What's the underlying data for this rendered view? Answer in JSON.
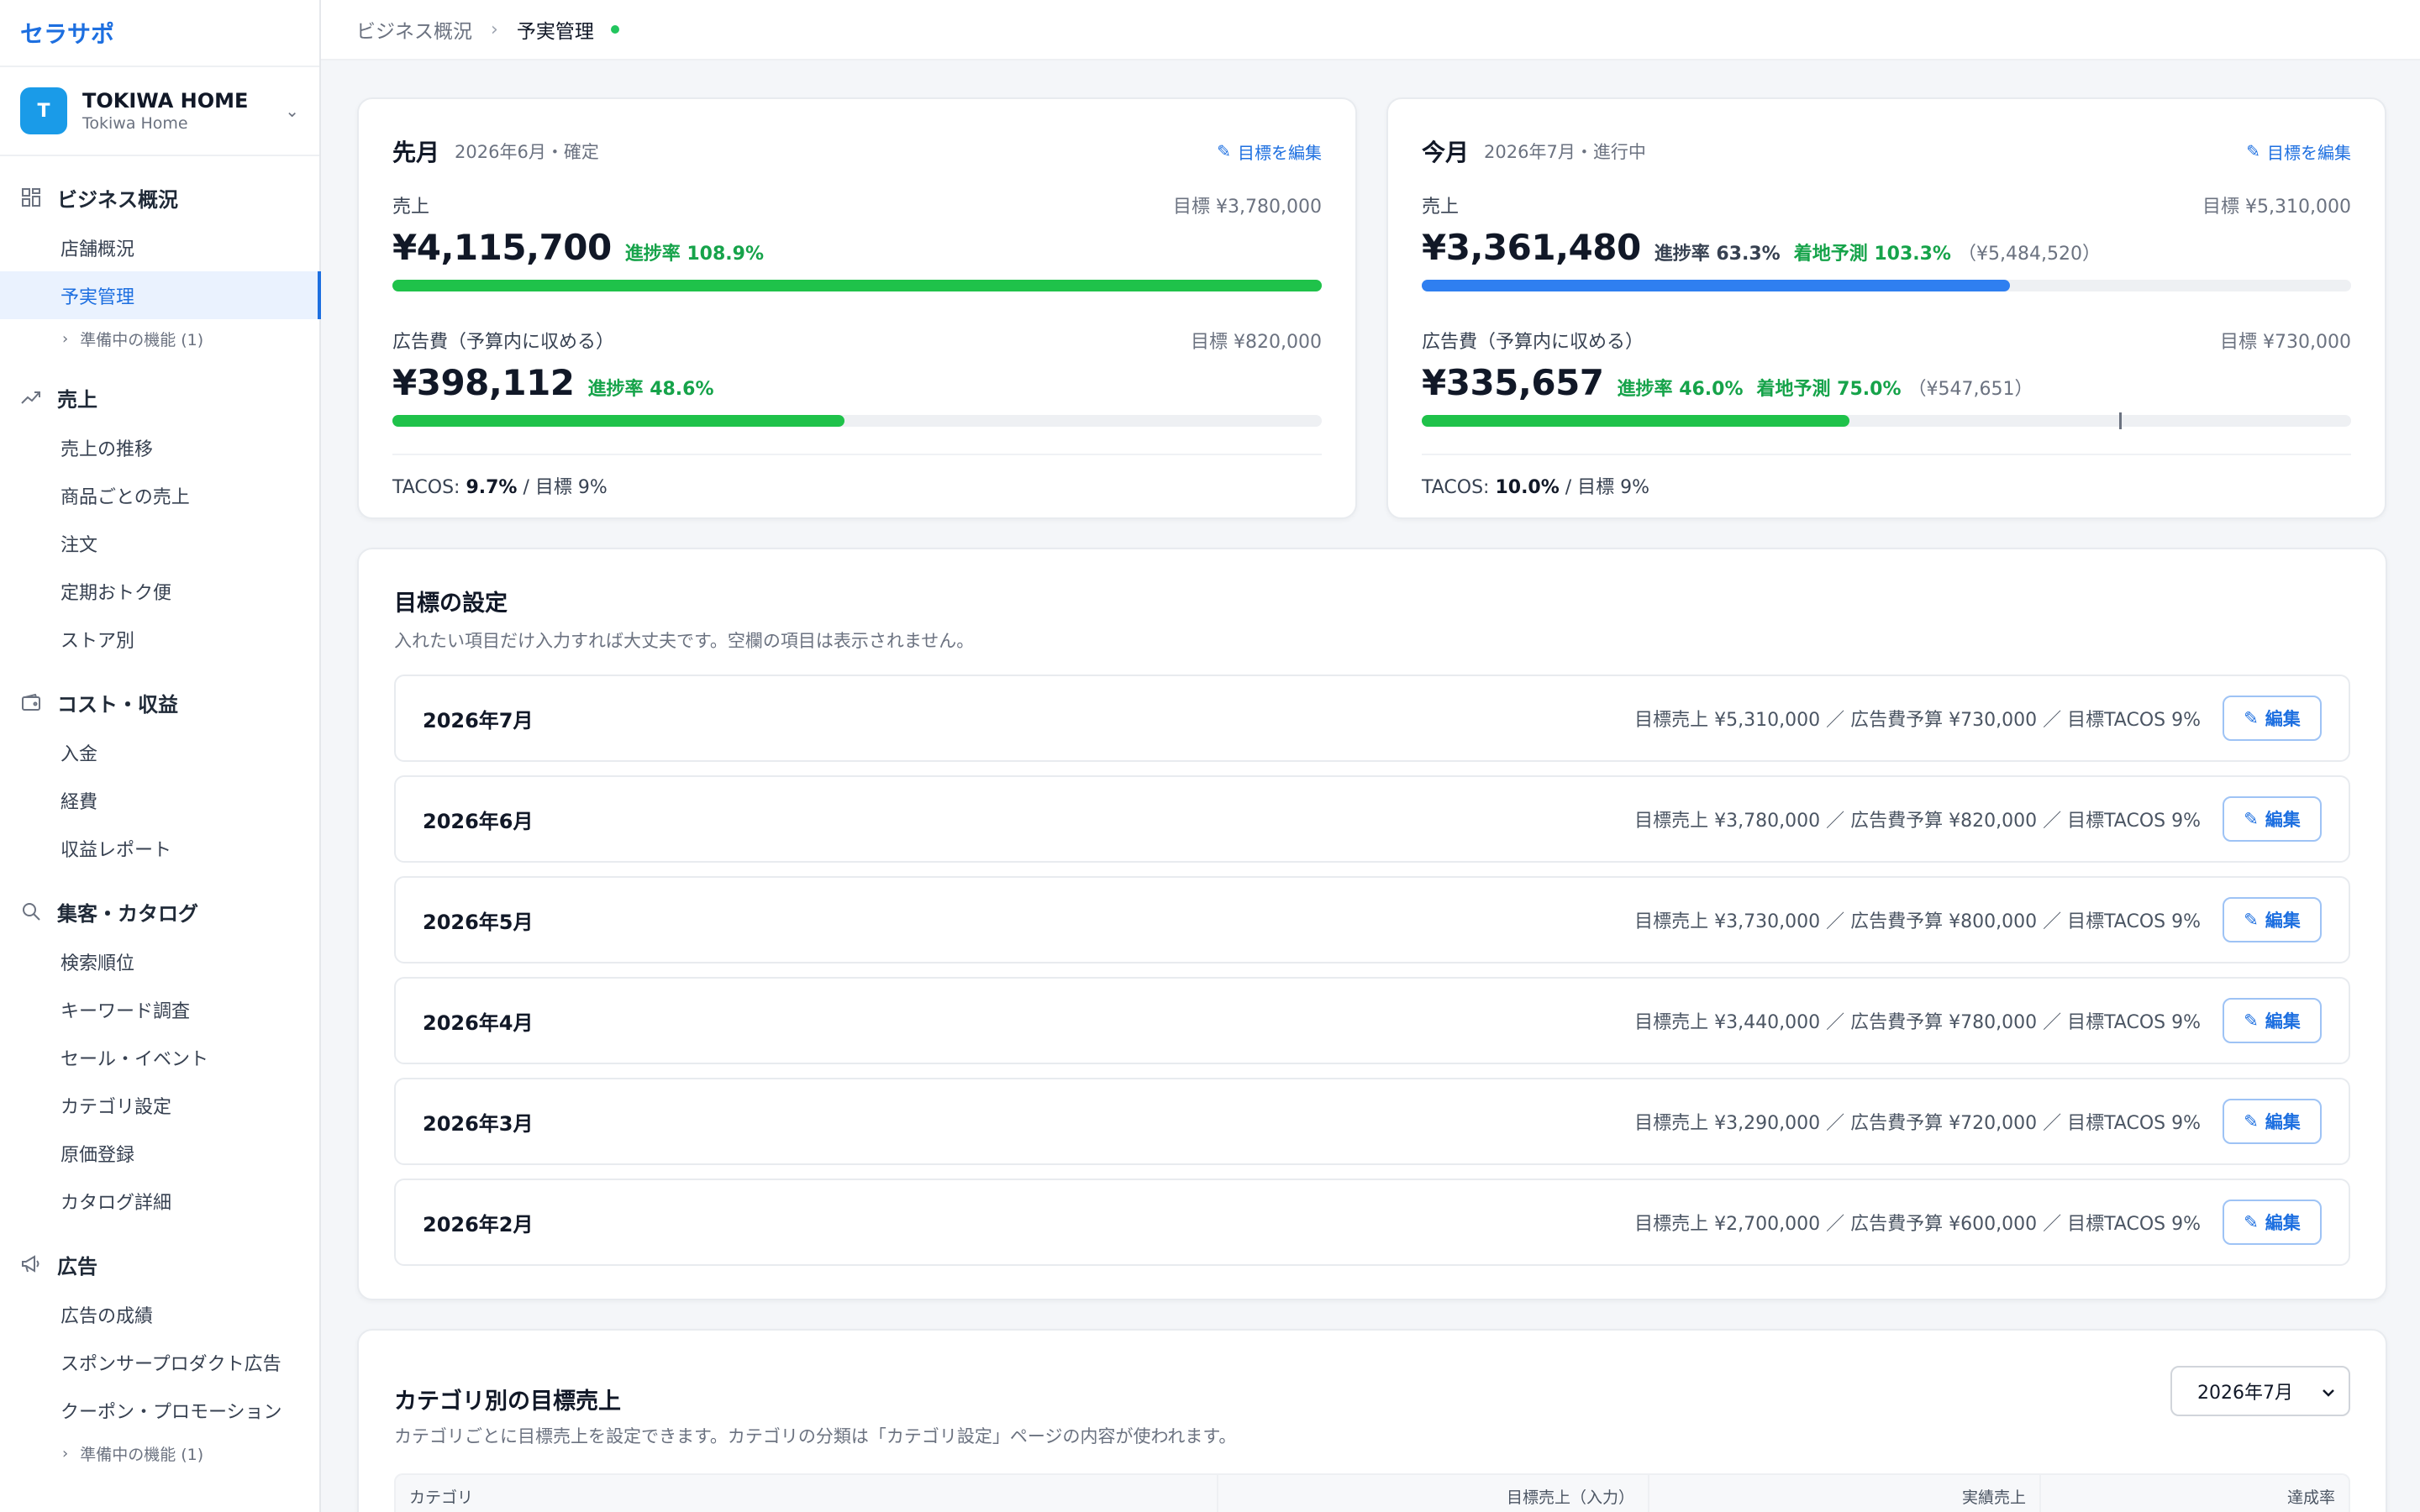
{
  "app": {
    "brand": "セラサポ"
  },
  "workspace": {
    "avatar": "T",
    "name": "TOKIWA HOME",
    "sub": "Tokiwa Home"
  },
  "nav": {
    "business": {
      "label": "ビジネス概況",
      "items": [
        "店舗概況",
        "予実管理"
      ],
      "more": "準備中の機能 (1)"
    },
    "sales": {
      "label": "売上",
      "items": [
        "売上の推移",
        "商品ごとの売上",
        "注文",
        "定期おトク便",
        "ストア別"
      ]
    },
    "cost": {
      "label": "コスト・収益",
      "items": [
        "入金",
        "経費",
        "収益レポート"
      ]
    },
    "acquisition": {
      "label": "集客・カタログ",
      "items": [
        "検索順位",
        "キーワード調査",
        "セール・イベント",
        "カテゴリ設定",
        "原価登録",
        "カタログ詳細"
      ]
    },
    "ads": {
      "label": "広告",
      "items": [
        "広告の成績",
        "スポンサープロダクト広告",
        "クーポン・プロモーション"
      ],
      "more": "準備中の機能 (1)"
    }
  },
  "breadcrumb": {
    "parent": "ビジネス概況",
    "current": "予実管理"
  },
  "cards": {
    "last_month": {
      "title": "先月",
      "sub": "2026年6月・確定",
      "edit": "目標を編集",
      "sales_label": "売上",
      "sales_target": "目標 ¥3,780,000",
      "sales_value": "¥4,115,700",
      "sales_rate": "進捗率 108.9%",
      "sales_progress": 1.0,
      "ad_label": "広告費（予算内に収める）",
      "ad_target": "目標 ¥820,000",
      "ad_value": "¥398,112",
      "ad_rate": "進捗率 48.6%",
      "ad_progress": 0.486,
      "tacos_prefix": "TACOS: ",
      "tacos_value": "9.7%",
      "tacos_suffix": " / 目標 9%"
    },
    "this_month": {
      "title": "今月",
      "sub": "2026年7月・進行中",
      "edit": "目標を編集",
      "sales_label": "売上",
      "sales_target": "目標 ¥5,310,000",
      "sales_value": "¥3,361,480",
      "sales_rate": "進捗率 63.3%",
      "sales_forecast": "着地予測 103.3%",
      "sales_forecast_amount": "（¥5,484,520）",
      "sales_progress": 0.633,
      "ad_label": "広告費（予算内に収める）",
      "ad_target": "目標 ¥730,000",
      "ad_value": "¥335,657",
      "ad_rate": "進捗率 46.0%",
      "ad_forecast": "着地予測 75.0%",
      "ad_forecast_amount": "（¥547,651）",
      "ad_progress": 0.46,
      "ad_forecast_marker": 0.75,
      "tacos_prefix": "TACOS: ",
      "tacos_value": "10.0%",
      "tacos_suffix": " / 目標 9%"
    }
  },
  "goals": {
    "title": "目標の設定",
    "desc": "入れたい項目だけ入力すれば大丈夫です。空欄の項目は表示されません。",
    "edit_label": "編集",
    "rows": [
      {
        "month": "2026年7月",
        "summary": "目標売上 ¥5,310,000 ／ 広告費予算 ¥730,000 ／ 目標TACOS 9%"
      },
      {
        "month": "2026年6月",
        "summary": "目標売上 ¥3,780,000 ／ 広告費予算 ¥820,000 ／ 目標TACOS 9%"
      },
      {
        "month": "2026年5月",
        "summary": "目標売上 ¥3,730,000 ／ 広告費予算 ¥800,000 ／ 目標TACOS 9%"
      },
      {
        "month": "2026年4月",
        "summary": "目標売上 ¥3,440,000 ／ 広告費予算 ¥780,000 ／ 目標TACOS 9%"
      },
      {
        "month": "2026年3月",
        "summary": "目標売上 ¥3,290,000 ／ 広告費予算 ¥720,000 ／ 目標TACOS 9%"
      },
      {
        "month": "2026年2月",
        "summary": "目標売上 ¥2,700,000 ／ 広告費予算 ¥600,000 ／ 目標TACOS 9%"
      }
    ]
  },
  "category": {
    "title": "カテゴリ別の目標売上",
    "desc": "カテゴリごとに目標売上を設定できます。カテゴリの分類は「カテゴリ設定」ページの内容が使われます。",
    "selected_month": "2026年7月",
    "columns": [
      "カテゴリ",
      "目標売上（入力）",
      "実績売上",
      "達成率"
    ]
  },
  "colors": {
    "accent": "#1d6fe0",
    "green": "#1fc24a",
    "blue": "#2f7ff0",
    "track": "#eef0f3"
  },
  "icons": {
    "business": "grid-icon",
    "sales": "trend-up-icon",
    "cost": "wallet-icon",
    "acquisition": "search-icon",
    "ads": "megaphone-icon",
    "edit": "pencil-icon",
    "chevron": "chevron-down-icon",
    "expand": "chevron-right-icon"
  }
}
